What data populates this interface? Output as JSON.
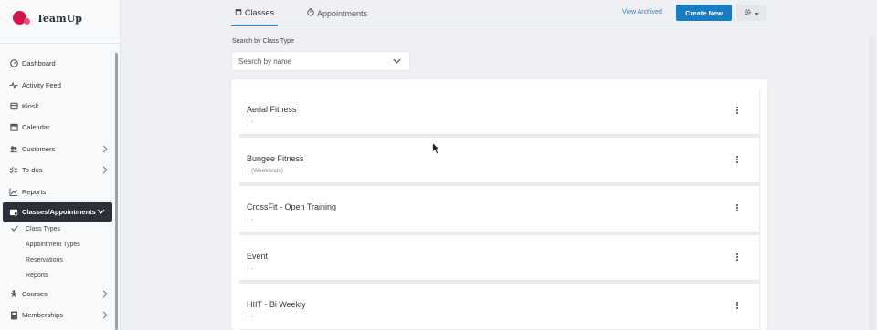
{
  "app": {
    "name": "TeamUp"
  },
  "sidebar": {
    "items": [
      {
        "label": "Dashboard",
        "icon": "dashboard-icon"
      },
      {
        "label": "Activity Feed",
        "icon": "activity-icon"
      },
      {
        "label": "Kiosk",
        "icon": "kiosk-icon"
      },
      {
        "label": "Calendar",
        "icon": "calendar-icon"
      },
      {
        "label": "Customers",
        "icon": "customers-icon",
        "has_chevron": true
      },
      {
        "label": "To-dos",
        "icon": "todos-icon",
        "has_chevron": true
      },
      {
        "label": "Reports",
        "icon": "reports-icon"
      },
      {
        "label": "Classes/Appointments",
        "icon": "classes-icon",
        "active": true
      },
      {
        "label": "Courses",
        "icon": "courses-icon",
        "has_chevron": true
      },
      {
        "label": "Memberships",
        "icon": "memberships-icon",
        "has_chevron": true
      }
    ],
    "subitems": [
      {
        "label": "Class Types",
        "checked": true
      },
      {
        "label": "Appointment Types"
      },
      {
        "label": "Reservations"
      },
      {
        "label": "Reports"
      }
    ]
  },
  "tabs": [
    {
      "label": "Classes",
      "active": true
    },
    {
      "label": "Appointments"
    }
  ],
  "toolbar": {
    "view_archived": "View Archived",
    "create_new": "Create New"
  },
  "search": {
    "label": "Search by Class Type",
    "placeholder": "Search by name"
  },
  "class_types": [
    {
      "name": "Aerial Fitness",
      "detail": "-"
    },
    {
      "name": "Bungee Fitness",
      "detail": "(Weekends)"
    },
    {
      "name": "CrossFit - Open Training",
      "detail": "-"
    },
    {
      "name": "Event",
      "detail": "-"
    },
    {
      "name": "HIIT - Bi Weekly",
      "detail": "-"
    }
  ],
  "colors": {
    "brand": "#d2154a",
    "accent": "#1a7dc4",
    "sidebar_active": "#2d3039"
  }
}
